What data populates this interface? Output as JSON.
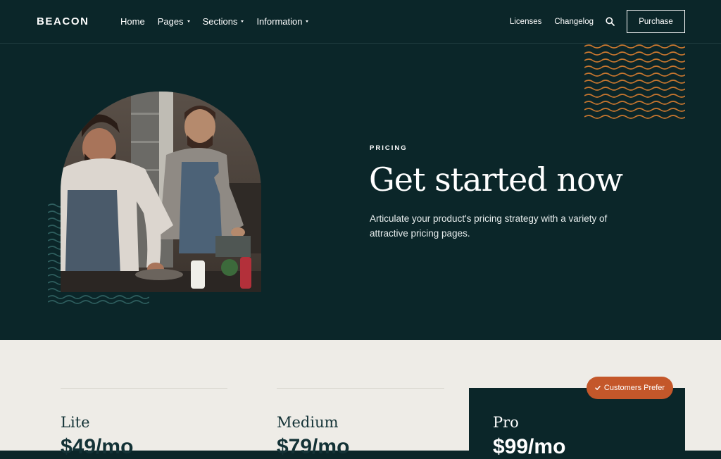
{
  "nav": {
    "logo": "BEACON",
    "menu": [
      {
        "label": "Home",
        "has_dropdown": false
      },
      {
        "label": "Pages",
        "has_dropdown": true
      },
      {
        "label": "Sections",
        "has_dropdown": true
      },
      {
        "label": "Information",
        "has_dropdown": true
      }
    ],
    "right_links": [
      "Licenses",
      "Changelog"
    ],
    "search_icon": "search-icon",
    "purchase_label": "Purchase"
  },
  "hero": {
    "eyebrow": "PRICING",
    "title": "Get started now",
    "description": "Articulate your product's pricing strategy with a variety of attractive pricing pages.",
    "image": "two chefs cooking in a kitchen"
  },
  "pricing": {
    "plans": [
      {
        "name": "Lite",
        "price": "$49/mo"
      },
      {
        "name": "Medium",
        "price": "$79/mo"
      },
      {
        "name": "Pro",
        "price": "$99/mo",
        "featured": true
      }
    ],
    "badge": {
      "icon": "check-icon",
      "label": "Customers Prefer"
    }
  },
  "colors": {
    "dark_teal": "#0b2629",
    "cream": "#eeece7",
    "accent_orange": "#c4572a",
    "wave_orange": "#c9772f",
    "wave_teal": "#2f5f5f"
  }
}
